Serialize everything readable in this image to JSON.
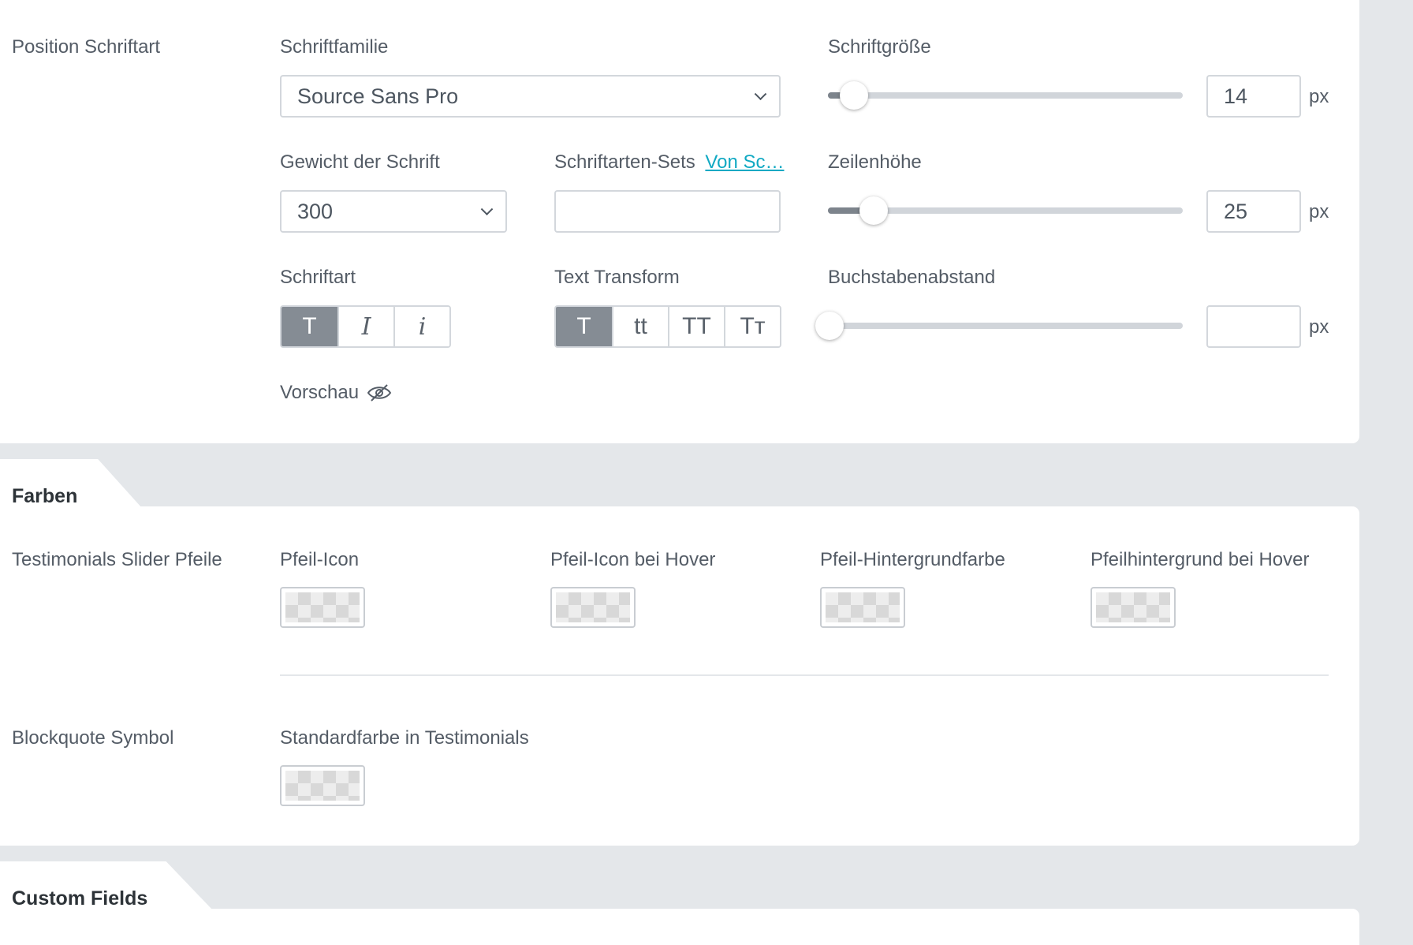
{
  "typography": {
    "row_label": "Position Schriftart",
    "font_family": {
      "label": "Schriftfamilie",
      "value": "Source Sans Pro"
    },
    "font_size": {
      "label": "Schriftgröße",
      "value": "14",
      "unit": "px",
      "slider_fraction": 0.07
    },
    "font_weight": {
      "label": "Gewicht der Schrift",
      "value": "300"
    },
    "font_sets": {
      "label": "Schriftarten-Sets",
      "link": "Von Sc…",
      "value": ""
    },
    "line_height": {
      "label": "Zeilenhöhe",
      "value": "25",
      "unit": "px",
      "slider_fraction": 0.13
    },
    "font_style": {
      "label": "Schriftart",
      "buttons": [
        "T",
        "I",
        "i"
      ]
    },
    "text_transform": {
      "label": "Text Transform",
      "buttons": [
        "T",
        "tt",
        "TT",
        "Tт"
      ]
    },
    "letter_spacing": {
      "label": "Buchstabenabstand",
      "value": "",
      "unit": "px",
      "slider_fraction": 0.0
    },
    "preview": {
      "label": "Vorschau"
    }
  },
  "colors": {
    "title": "Farben",
    "slider_arrows": {
      "row_label": "Testimonials Slider Pfeile",
      "items": [
        "Pfeil-Icon",
        "Pfeil-Icon bei Hover",
        "Pfeil-Hintergrundfarbe",
        "Pfeilhintergrund bei Hover"
      ]
    },
    "blockquote": {
      "row_label": "Blockquote Symbol",
      "item": "Standardfarbe in Testimonials"
    }
  },
  "custom_fields": {
    "title": "Custom Fields"
  },
  "theme": {
    "active_button": "#858c94",
    "link": "#10a9c3",
    "background": "#e4e7ea"
  }
}
